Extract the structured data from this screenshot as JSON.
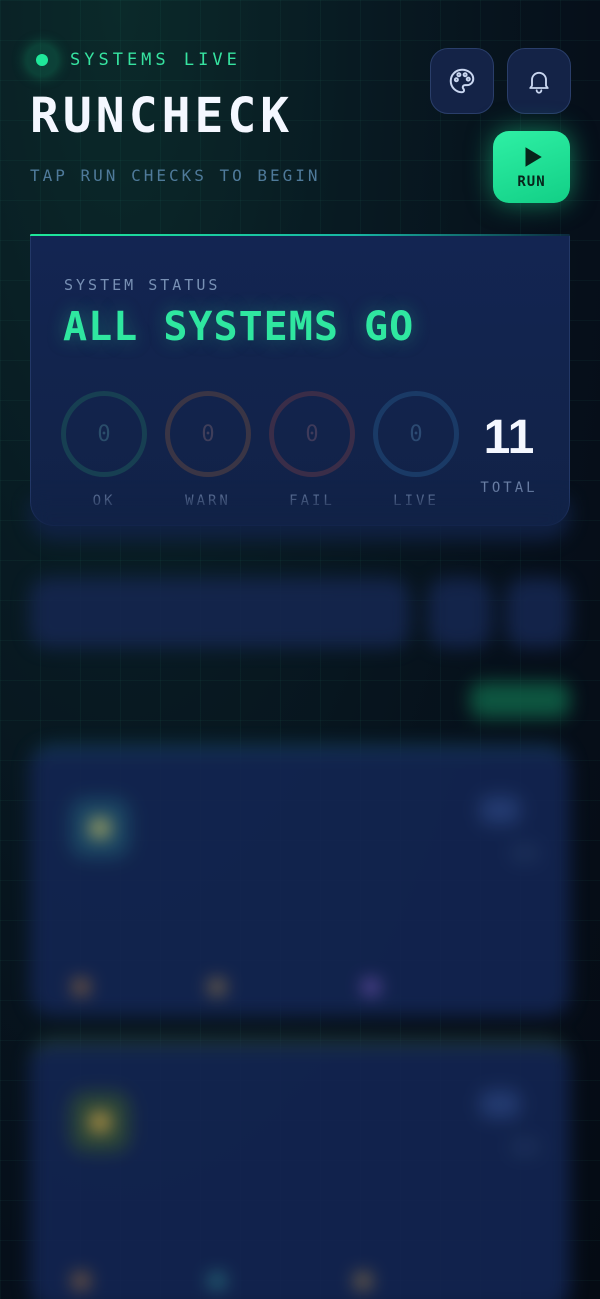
{
  "header": {
    "status_text": "SYSTEMS LIVE",
    "app_title": "RUNCHECK",
    "subtitle": "TAP RUN CHECKS TO BEGIN",
    "run_button_label": "RUN",
    "palette_icon": "palette-icon",
    "bell_icon": "bell-icon",
    "play_icon": "play-icon"
  },
  "status_card": {
    "label": "SYSTEM STATUS",
    "headline": "ALL SYSTEMS GO",
    "counters": [
      {
        "label": "OK",
        "value": "0",
        "color": "#1fe89a"
      },
      {
        "label": "WARN",
        "value": "0",
        "color": "#f0a23a"
      },
      {
        "label": "FAIL",
        "value": "0",
        "color": "#e0505a"
      },
      {
        "label": "LIVE",
        "value": "0",
        "color": "#3a8df0"
      }
    ],
    "total_value": "11",
    "total_label": "TOTAL"
  },
  "colors": {
    "accent": "#1fe89a",
    "card_bg": "#132552",
    "page_bg": "#060f1a"
  }
}
